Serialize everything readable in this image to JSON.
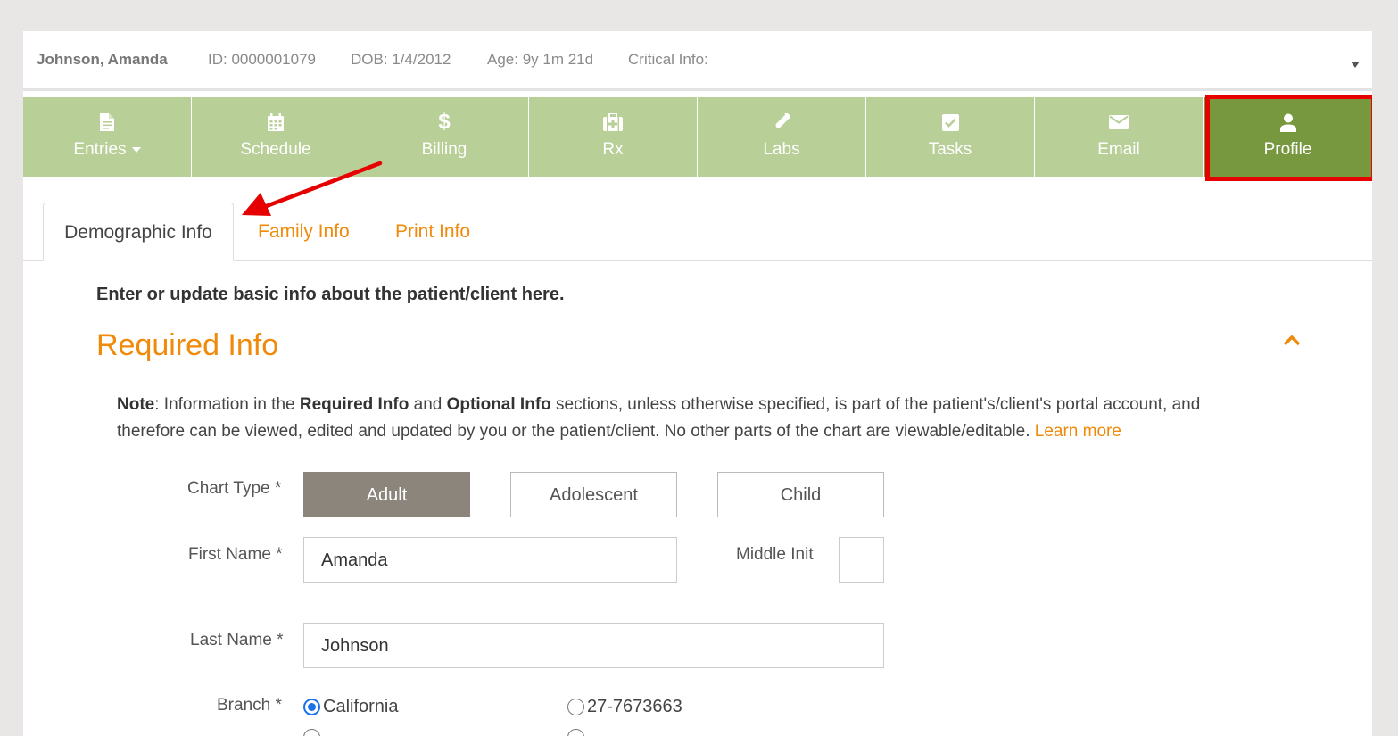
{
  "patient": {
    "name": "Johnson, Amanda",
    "id": "ID: 0000001079",
    "dob": "DOB: 1/4/2012",
    "age": "Age: 9y 1m 21d",
    "critical_info": "Critical Info:"
  },
  "nav": [
    {
      "label": "Entries",
      "icon": "file-icon"
    },
    {
      "label": "Schedule",
      "icon": "calendar-icon"
    },
    {
      "label": "Billing",
      "icon": "dollar-icon"
    },
    {
      "label": "Rx",
      "icon": "medkit-icon"
    },
    {
      "label": "Labs",
      "icon": "test-tube-icon"
    },
    {
      "label": "Tasks",
      "icon": "checkbox-icon"
    },
    {
      "label": "Email",
      "icon": "envelope-icon"
    },
    {
      "label": "Profile",
      "icon": "user-icon",
      "active": true
    }
  ],
  "tabs": {
    "demographic": "Demographic Info",
    "family": "Family Info",
    "print": "Print Info"
  },
  "intro": "Enter or update basic info about the patient/client here.",
  "section_title": "Required Info",
  "note": {
    "label": "Note",
    "part1": ": Information in the ",
    "bold1": "Required Info",
    "part2": " and ",
    "bold2": "Optional Info",
    "part3": " sections, unless otherwise specified, is part of the patient's/client's portal account, and therefore can be viewed, edited and updated by you or the patient/client. No other parts of the chart are viewable/editable. ",
    "link": "Learn more"
  },
  "form": {
    "chart_type_label": "Chart Type *",
    "chart_types": [
      "Adult",
      "Adolescent",
      "Child"
    ],
    "chart_type_selected": "Adult",
    "first_name_label": "First Name *",
    "first_name": "Amanda",
    "middle_init_label": "Middle Init",
    "middle_init": "",
    "last_name_label": "Last Name *",
    "last_name": "Johnson",
    "branch_label": "Branch *",
    "branches": [
      "California",
      "27-7673663"
    ],
    "branch_selected": "California"
  },
  "colors": {
    "nav_bg": "#b8cf97",
    "nav_active": "#77983f",
    "accent": "#ef8a0a",
    "selected_button": "#8c857c",
    "highlight_box": "#e60000"
  }
}
